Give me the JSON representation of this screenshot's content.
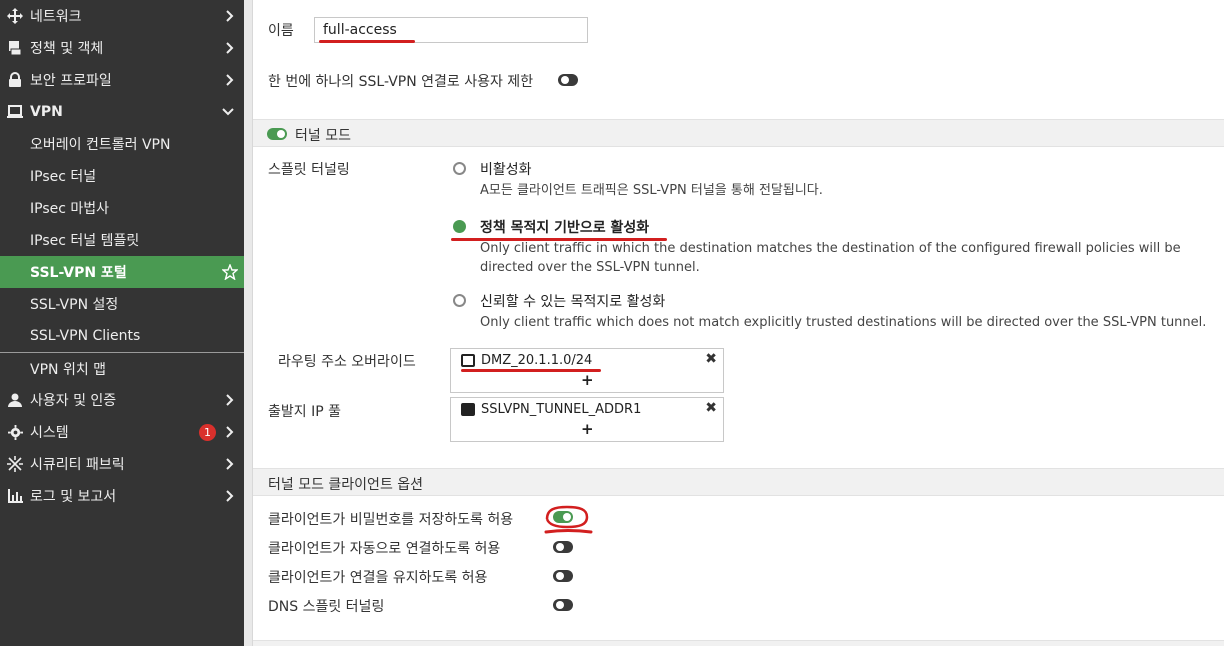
{
  "sidebar": {
    "items": [
      {
        "label": "네트워크",
        "icon": "move-arrows-icon"
      },
      {
        "label": "정책 및 객체",
        "icon": "policy-doc-icon"
      },
      {
        "label": "보안 프로파일",
        "icon": "lock-icon"
      },
      {
        "label": "VPN",
        "icon": "laptop-icon"
      },
      {
        "label": "오버레이 컨트롤러 VPN"
      },
      {
        "label": "IPsec 터널"
      },
      {
        "label": "IPsec 마법사"
      },
      {
        "label": "IPsec 터널 템플릿"
      },
      {
        "label": "SSL-VPN 포털"
      },
      {
        "label": "SSL-VPN 설정"
      },
      {
        "label": "SSL-VPN Clients"
      },
      {
        "label": "VPN 위치 맵"
      },
      {
        "label": "사용자 및 인증",
        "icon": "user-icon"
      },
      {
        "label": "시스템",
        "icon": "gear-icon",
        "badge": "1"
      },
      {
        "label": "시큐리티 패브릭",
        "icon": "fabric-icon"
      },
      {
        "label": "로그 및 보고서",
        "icon": "chart-icon"
      }
    ]
  },
  "form": {
    "name_label": "이름",
    "name_value": "full-access",
    "limit_label": "한 번에 하나의 SSL-VPN 연결로 사용자 제한",
    "tunnel_mode_label": "터널 모드",
    "split_label": "스플릿 터널링",
    "radio": [
      {
        "title": "비활성화",
        "desc": "A모든 클라이언트 트래픽은 SSL-VPN 터널을 통해 전달됩니다."
      },
      {
        "title": "정책 목적지 기반으로 활성화",
        "desc": "Only client traffic in which the destination matches the destination of the configured firewall policies will be directed over the SSL-VPN tunnel."
      },
      {
        "title": "신뢰할 수 있는 목적지로 활성화",
        "desc": "Only client traffic which does not match explicitly trusted destinations will be directed over the SSL-VPN tunnel."
      }
    ],
    "routing_label": "라우팅 주소 오버라이드",
    "routing_entry": "DMZ_20.1.1.0/24",
    "pool_label": "출발지 IP 풀",
    "pool_entry": "SSLVPN_TUNNEL_ADDR1",
    "plus": "+",
    "close": "✖",
    "client_options_label": "터널 모드 클라이언트 옵션",
    "options": [
      {
        "label": "클라이언트가 비밀번호를 저장하도록 허용",
        "on": true
      },
      {
        "label": "클라이언트가 자동으로 연결하도록 허용",
        "on": false
      },
      {
        "label": "클라이언트가 연결을 유지하도록 허용",
        "on": false
      },
      {
        "label": "DNS 스플릿 터널링",
        "on": false
      }
    ]
  },
  "colors": {
    "accent": "#4a9a52",
    "annotation": "#d21f1f",
    "sidebar_bg": "#343434"
  }
}
